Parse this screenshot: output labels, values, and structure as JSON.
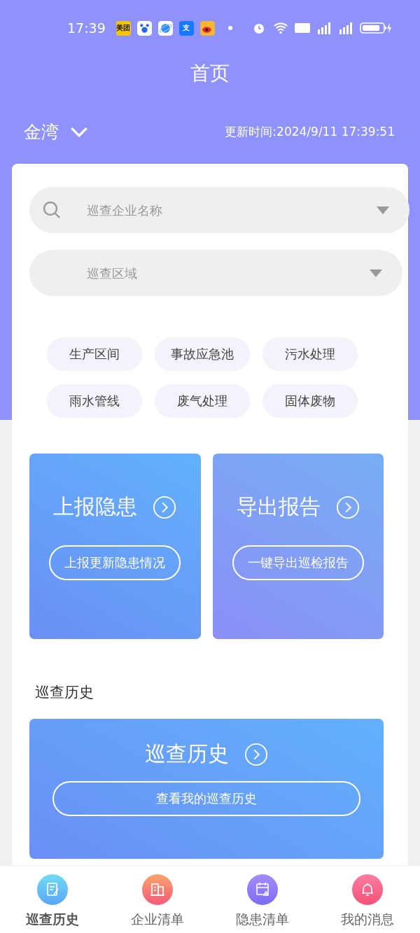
{
  "status_bar": {
    "time": "17:39",
    "apps": [
      {
        "kind": "text",
        "label": "美团"
      },
      {
        "kind": "paw"
      },
      {
        "kind": "planet"
      },
      {
        "kind": "text",
        "label": "支"
      },
      {
        "kind": "eye"
      }
    ]
  },
  "header": {
    "title": "首页",
    "location": "金湾",
    "updated": "更新时间:2024/9/11 17:39:51"
  },
  "search": {
    "placeholder": "巡查企业名称"
  },
  "area": {
    "placeholder": "巡查区域"
  },
  "chips": [
    "生产区间",
    "事故应急池",
    "污水处理",
    "雨水管线",
    "废气处理",
    "固体废物"
  ],
  "actions": [
    {
      "title": "上报隐患",
      "button": "上报更新隐患情况",
      "kind": "blue"
    },
    {
      "title": "导出报告",
      "button": "一键导出巡检报告",
      "kind": "violet"
    }
  ],
  "history": {
    "heading": "巡查历史",
    "title": "巡查历史",
    "button": "查看我的巡查历史"
  },
  "tabs": [
    {
      "label": "巡查历史",
      "kind": "note",
      "selected": true
    },
    {
      "label": "企业清单",
      "kind": "building",
      "selected": false
    },
    {
      "label": "隐患清单",
      "kind": "calendar",
      "selected": false
    },
    {
      "label": "我的消息",
      "kind": "bell",
      "selected": false
    }
  ]
}
